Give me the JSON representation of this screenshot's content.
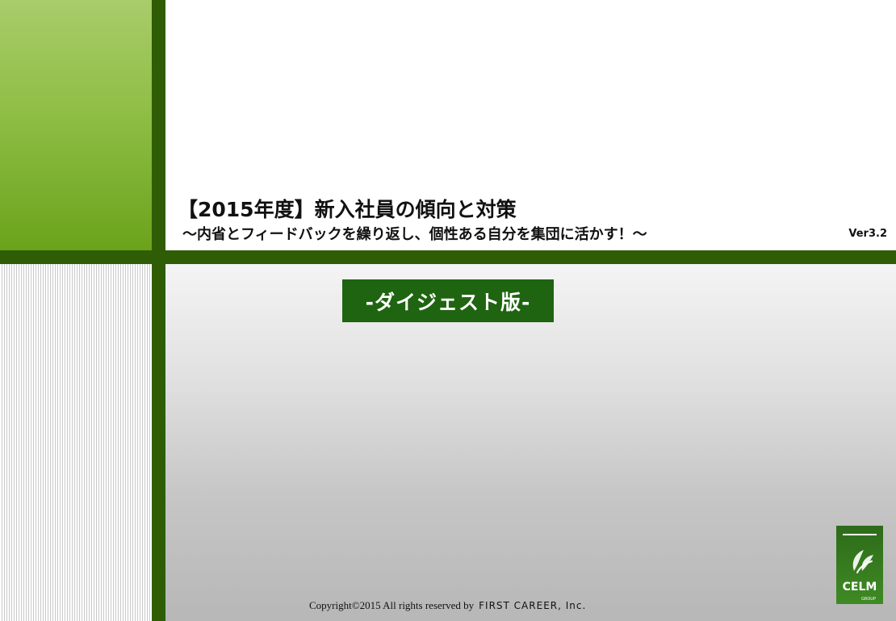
{
  "slide": {
    "title": "【2015年度】新入社員の傾向と対策",
    "subtitle": "～内省とフィードバックを繰り返し、個性ある自分を集団に活かす！～",
    "version": "Ver3.2",
    "badge": "-ダイジェスト版-",
    "copyright": "Copyright©2015 All rights reserved by",
    "company": "FIRST CAREER, Inc.",
    "logo_text": "CELM",
    "logo_subtext": "GROUP"
  },
  "colors": {
    "dark_green": "#2e5d05",
    "light_green": "#8fbe45",
    "badge_green": "#1f6410"
  },
  "icons": {
    "logo": "celm-group-logo"
  }
}
